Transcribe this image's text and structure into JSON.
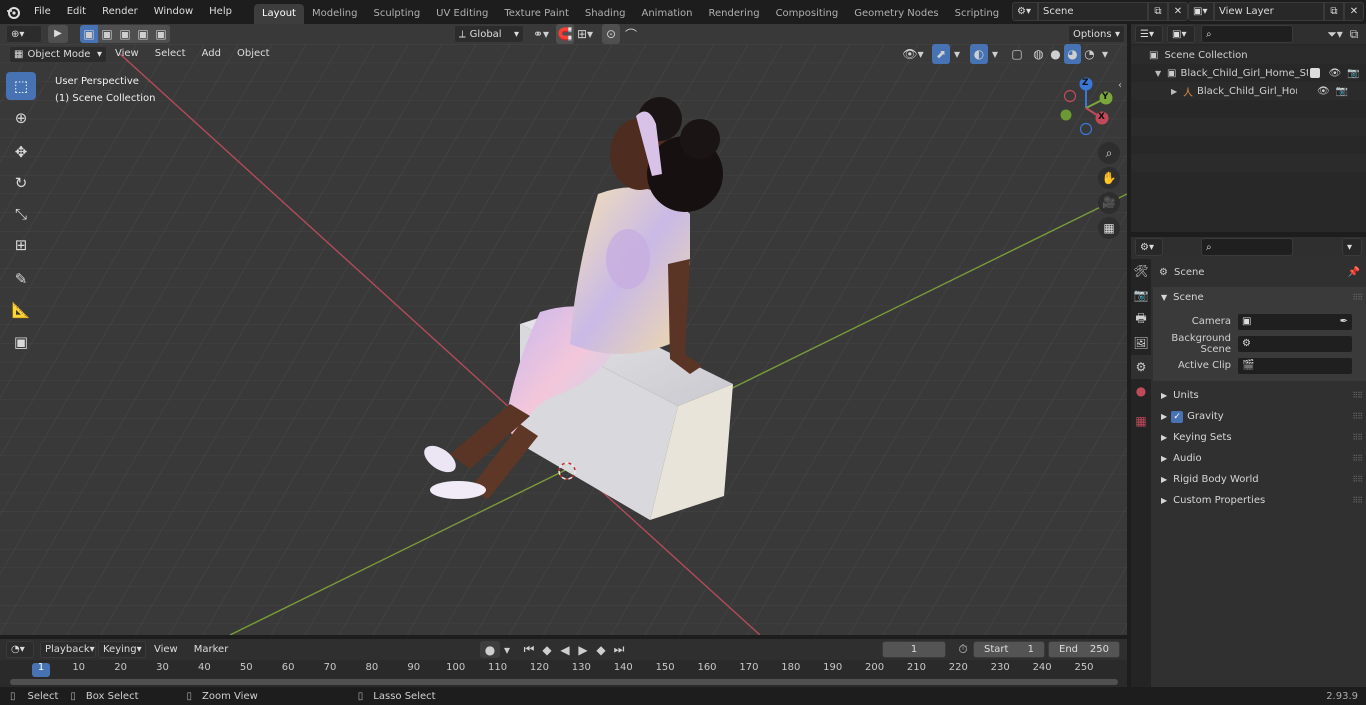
{
  "topbar": {
    "menus": [
      "File",
      "Edit",
      "Render",
      "Window",
      "Help"
    ],
    "workspaces": [
      "Layout",
      "Modeling",
      "Sculpting",
      "UV Editing",
      "Texture Paint",
      "Shading",
      "Animation",
      "Rendering",
      "Compositing",
      "Geometry Nodes",
      "Scripting"
    ],
    "active_workspace": "Layout",
    "scene_name": "Scene",
    "view_layer": "View Layer"
  },
  "viewport_header": {
    "mode": "Object Mode",
    "menus": [
      "View",
      "Select",
      "Add",
      "Object"
    ],
    "transform_orientation": "Global",
    "options_label": "Options"
  },
  "viewport": {
    "perspective_label": "User Perspective",
    "collection_label": "(1) Scene Collection",
    "gizmo_axes": [
      "X",
      "Y",
      "Z"
    ]
  },
  "outliner": {
    "search_placeholder": "",
    "root": "Scene Collection",
    "items": [
      {
        "label": "Black_Child_Girl_Home_Style_",
        "indent": 1
      },
      {
        "label": "Black_Child_Girl_Home_S",
        "indent": 2
      }
    ]
  },
  "properties": {
    "header_title": "Scene",
    "section": "Scene",
    "fields": [
      {
        "label": "Camera",
        "value": ""
      },
      {
        "label": "Background Scene",
        "value": ""
      },
      {
        "label": "Active Clip",
        "value": ""
      }
    ],
    "panels": [
      "Units",
      "Gravity",
      "Keying Sets",
      "Audio",
      "Rigid Body World",
      "Custom Properties"
    ],
    "gravity_checked": true
  },
  "timeline": {
    "menus": [
      "Playback",
      "Keying",
      "View",
      "Marker"
    ],
    "current_frame": "1",
    "start_label": "Start",
    "start": "1",
    "end_label": "End",
    "end": "250",
    "ticks": [
      "1",
      "10",
      "20",
      "30",
      "40",
      "50",
      "60",
      "70",
      "80",
      "90",
      "100",
      "110",
      "120",
      "130",
      "140",
      "150",
      "160",
      "170",
      "180",
      "190",
      "200",
      "210",
      "220",
      "230",
      "240",
      "250"
    ]
  },
  "statusbar": {
    "items": [
      "Select",
      "Box Select",
      "Zoom View",
      "Lasso Select"
    ],
    "version": "2.93.9"
  },
  "colors": {
    "accent": "#4772b3",
    "x_axis": "#c04a5a",
    "y_axis": "#7aa83a",
    "z_axis": "#3a78d8"
  }
}
